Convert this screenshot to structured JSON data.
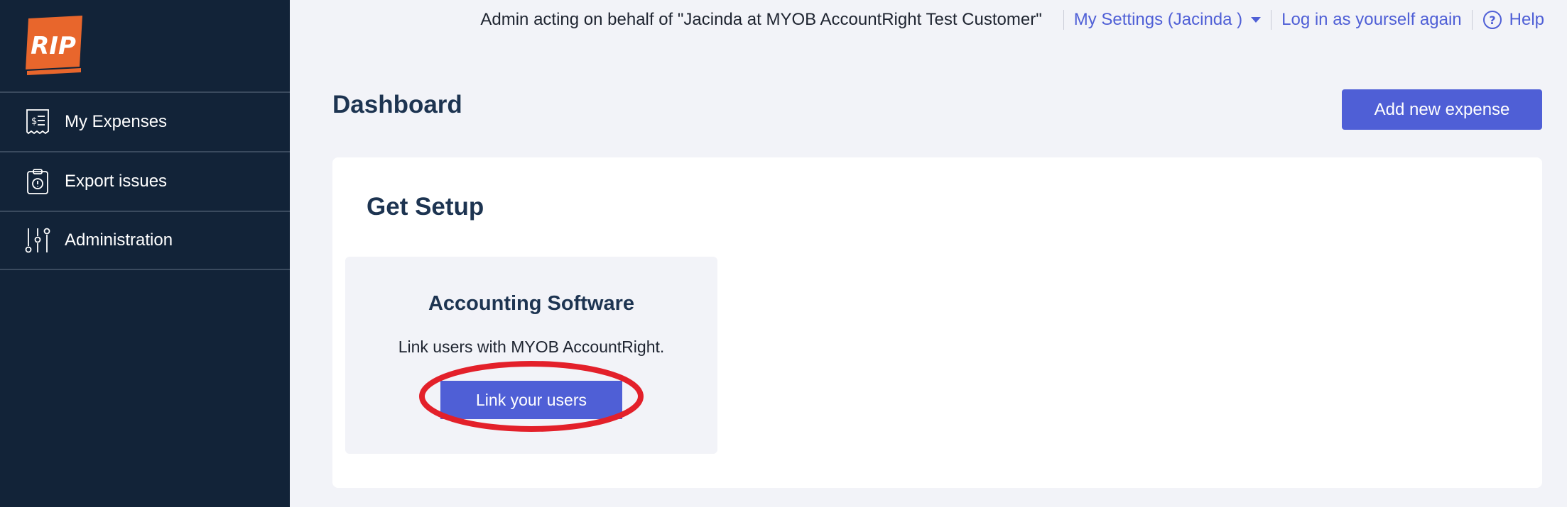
{
  "brand": {
    "logo_text": "RIP",
    "logo_color": "#e8662c"
  },
  "sidebar": {
    "items": [
      {
        "label": "My Expenses",
        "icon": "receipt-icon"
      },
      {
        "label": "Export issues",
        "icon": "clipboard-alert-icon"
      },
      {
        "label": "Administration",
        "icon": "sliders-icon"
      }
    ]
  },
  "topbar": {
    "acting_text": "Admin acting on behalf of \"Jacinda at MYOB AccountRight Test Customer\"",
    "settings_label": "My Settings (Jacinda )",
    "login_label": "Log in as yourself again",
    "help_label": "Help"
  },
  "main": {
    "title": "Dashboard",
    "add_button_label": "Add new expense"
  },
  "setup": {
    "title": "Get Setup",
    "tile": {
      "title": "Accounting Software",
      "description": "Link users with MYOB AccountRight.",
      "button_label": "Link your users"
    }
  },
  "colors": {
    "sidebar_bg": "#122338",
    "accent": "#4f5fd6",
    "heading": "#1d3451",
    "highlight": "#e3202a"
  }
}
